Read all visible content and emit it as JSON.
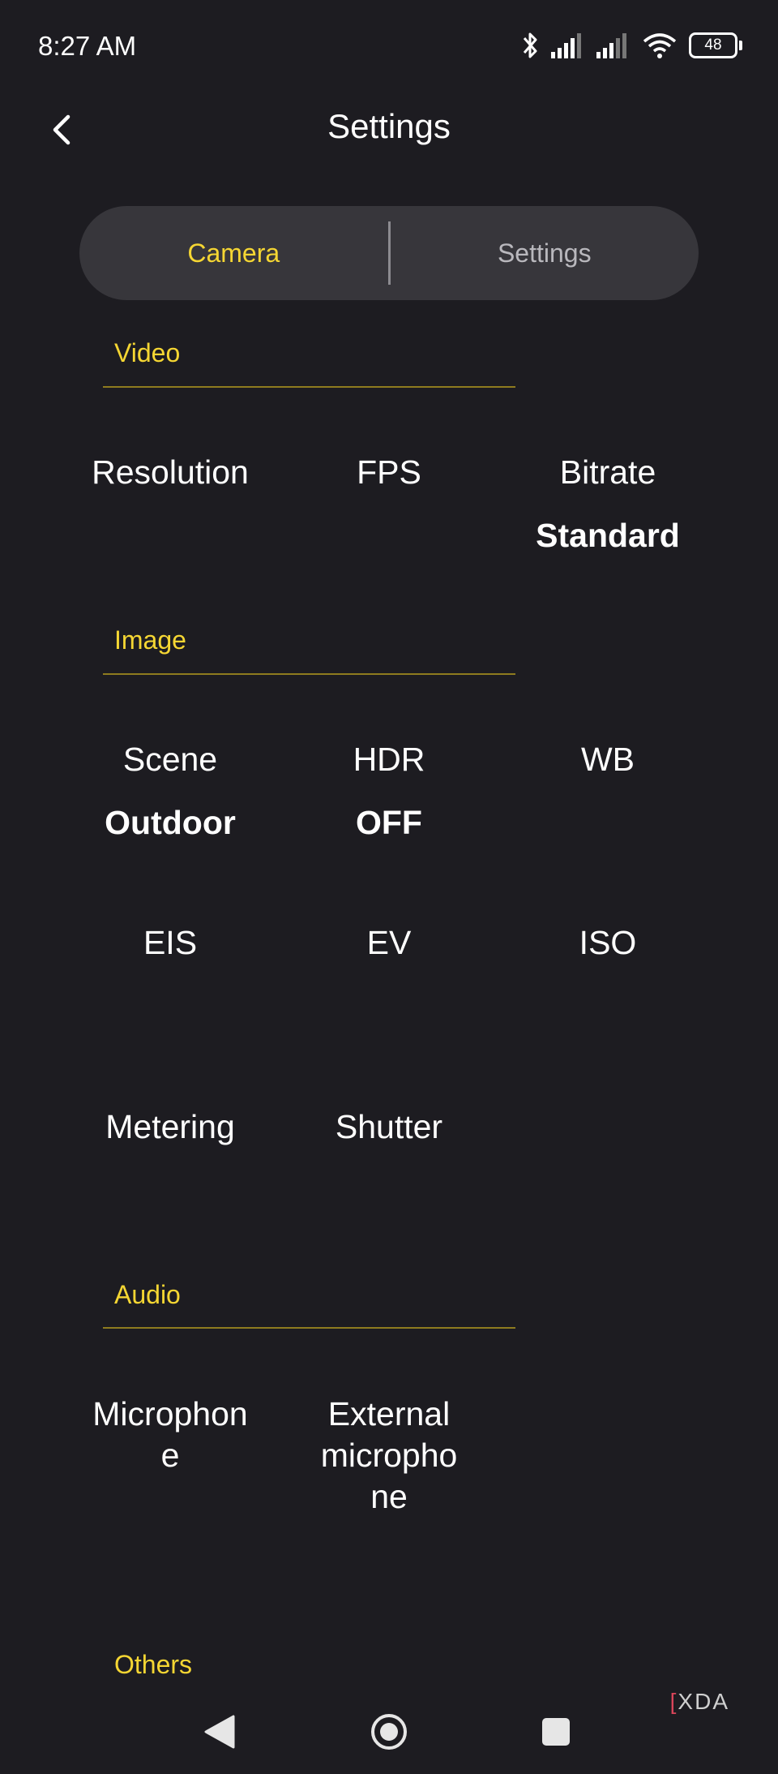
{
  "status_bar": {
    "time": "8:27 AM",
    "battery": "48"
  },
  "header": {
    "title": "Settings"
  },
  "tabs": [
    {
      "label": "Camera",
      "active": true
    },
    {
      "label": "Settings",
      "active": false
    }
  ],
  "sections": {
    "video": {
      "title": "Video",
      "items": [
        {
          "label": "Resolution",
          "value": ""
        },
        {
          "label": "FPS",
          "value": ""
        },
        {
          "label": "Bitrate",
          "value": "Standard"
        }
      ]
    },
    "image": {
      "title": "Image",
      "items": [
        {
          "label": "Scene",
          "value": "Outdoor"
        },
        {
          "label": "HDR",
          "value": "OFF"
        },
        {
          "label": "WB",
          "value": ""
        },
        {
          "label": "EIS",
          "value": ""
        },
        {
          "label": "EV",
          "value": ""
        },
        {
          "label": "ISO",
          "value": ""
        },
        {
          "label": "Metering",
          "value": ""
        },
        {
          "label": "Shutter",
          "value": ""
        }
      ]
    },
    "audio": {
      "title": "Audio",
      "items": [
        {
          "label": "Microphon\ne",
          "value": ""
        },
        {
          "label": "External\nmicropho\nne",
          "value": ""
        }
      ]
    },
    "others": {
      "title": "Others"
    }
  },
  "watermark": "XDA",
  "colors": {
    "accent": "#f5d633",
    "background": "#1d1c21",
    "segment_bg": "#37363b"
  }
}
